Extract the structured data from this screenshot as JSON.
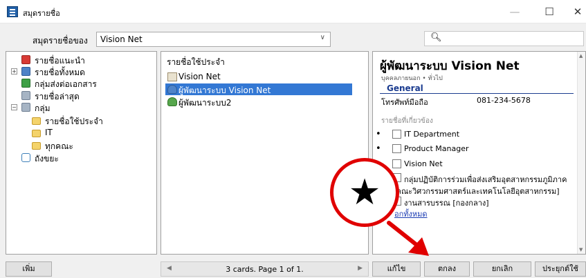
{
  "window": {
    "title": "สมุดรายชื่อ",
    "minimize_label": "—",
    "maximize_label": "☐",
    "close_label": "✕"
  },
  "toolbar": {
    "address_book_label": "สมุดรายชื่อของ",
    "address_book_value": "Vision Net",
    "search_placeholder": ""
  },
  "tree": {
    "items": [
      {
        "label": "รายชื่อแนะนำ",
        "icon": "suggested-contacts-icon"
      },
      {
        "label": "รายชื่อทั้งหมด",
        "icon": "all-contacts-icon"
      },
      {
        "label": "กลุ่มส่งต่อเอกสาร",
        "icon": "distribution-group-icon"
      },
      {
        "label": "รายชื่อล่าสุด",
        "icon": "recent-contacts-icon"
      },
      {
        "label": "กลุ่ม",
        "icon": "group-icon"
      },
      {
        "label": "รายชื่อใช้ประจำ",
        "icon": "folder-icon"
      },
      {
        "label": "IT",
        "icon": "folder-icon"
      },
      {
        "label": "ทุกคณะ",
        "icon": "folder-icon"
      },
      {
        "label": "ถังขยะ",
        "icon": "trash-icon"
      }
    ]
  },
  "list": {
    "header": "รายชื่อใช้ประจำ",
    "rows": [
      {
        "label": "Vision Net",
        "icon": "contact-card-icon"
      },
      {
        "label": "ผู้พัฒนาระบบ Vision Net",
        "icon": "person-icon"
      },
      {
        "label": "ผู้พัฒนาระบบ2",
        "icon": "person-icon"
      }
    ],
    "pager_text": "3 cards. Page 1 of 1."
  },
  "detail": {
    "name": "ผู้พัฒนาระบบ Vision Net",
    "subtitle": "บุคคลภายนอก • ทั่วไป",
    "section": "General",
    "field_label": "โทรศัพท์มือถือ",
    "field_value": "081-234-5678",
    "related_heading": "รายชื่อที่เกี่ยวข้อง",
    "related": [
      "IT Department",
      "Product Manager",
      "Vision Net"
    ],
    "related_long_line1": "กลุ่มปฏิบัติการร่วมเพื่อส่งเสริมอุตสาหกรรมภูมิภาค",
    "related_long_line2": "ตก [คณะวิศวกรรมศาสตร์และเทคโนโลยีอุตสาหกรรม]",
    "related_last": "งานสารบรรณ [กองกลาง]",
    "show_all": "อกทั้งหมด"
  },
  "buttons": {
    "add": "เพิ่ม",
    "edit": "แก้ไข",
    "ok": "ตกลง",
    "cancel": "ยกเลิก",
    "apply": "ประยุกต์ใช้"
  },
  "marker": {
    "symbol": "★",
    "color": "#e00000"
  }
}
